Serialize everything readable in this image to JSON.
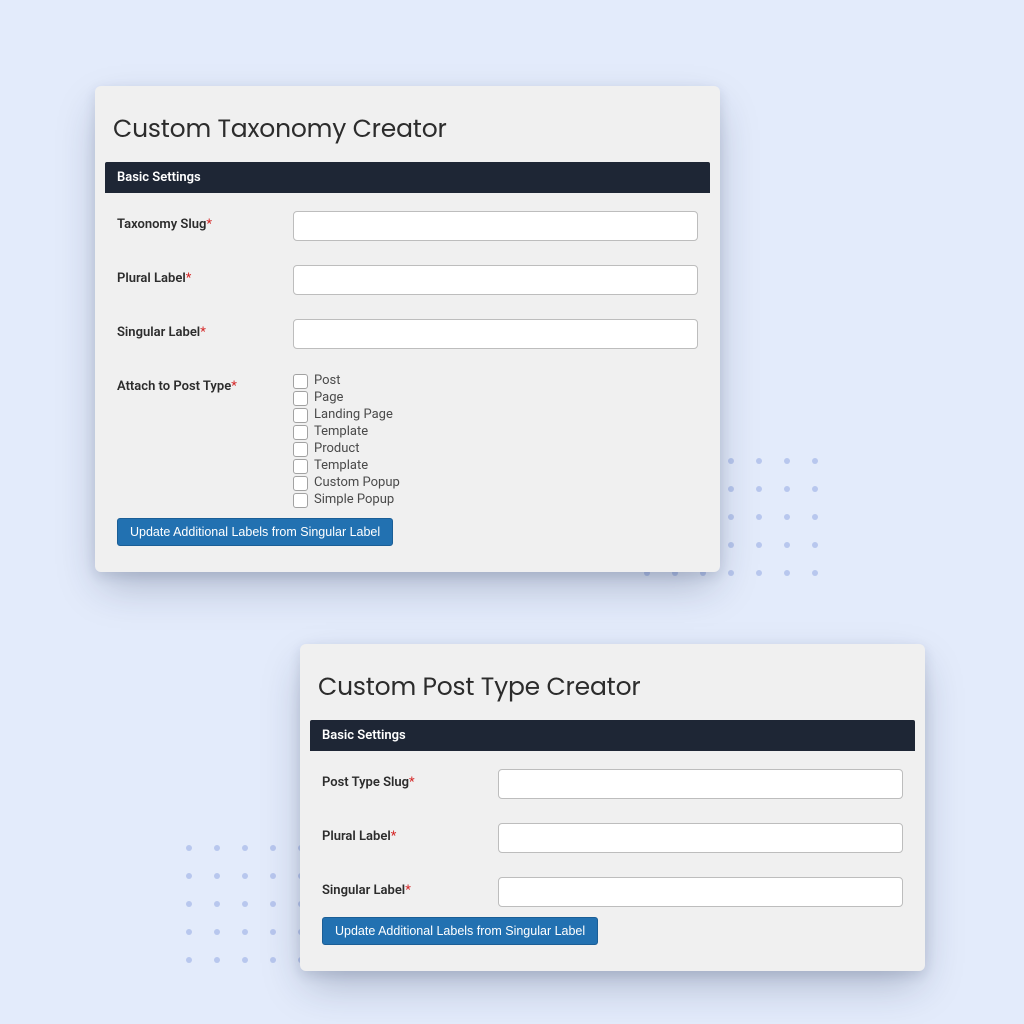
{
  "colors": {
    "page_bg": "#e3ebfb",
    "panel_bg": "#f0f0f0",
    "section_header_bg": "#1e2635",
    "button_bg": "#2271b1",
    "required_mark": "#d42323"
  },
  "panel1": {
    "title": "Custom Taxonomy Creator",
    "section_title": "Basic Settings",
    "fields": {
      "slug": {
        "label": "Taxonomy Slug",
        "required": "*",
        "value": ""
      },
      "plural": {
        "label": "Plural Label",
        "required": "*",
        "value": ""
      },
      "singular": {
        "label": "Singular Label",
        "required": "*",
        "value": ""
      },
      "attach": {
        "label": "Attach to Post Type",
        "required": "*",
        "options": [
          "Post",
          "Page",
          "Landing Page",
          "Template",
          "Product",
          "Template",
          "Custom Popup",
          "Simple Popup"
        ]
      }
    },
    "button_label": "Update Additional Labels from Singular Label"
  },
  "panel2": {
    "title": "Custom Post Type Creator",
    "section_title": "Basic Settings",
    "fields": {
      "slug": {
        "label": "Post Type Slug",
        "required": "*",
        "value": ""
      },
      "plural": {
        "label": "Plural Label",
        "required": "*",
        "value": ""
      },
      "singular": {
        "label": "Singular Label",
        "required": "*",
        "value": ""
      }
    },
    "button_label": "Update Additional Labels from Singular Label"
  }
}
